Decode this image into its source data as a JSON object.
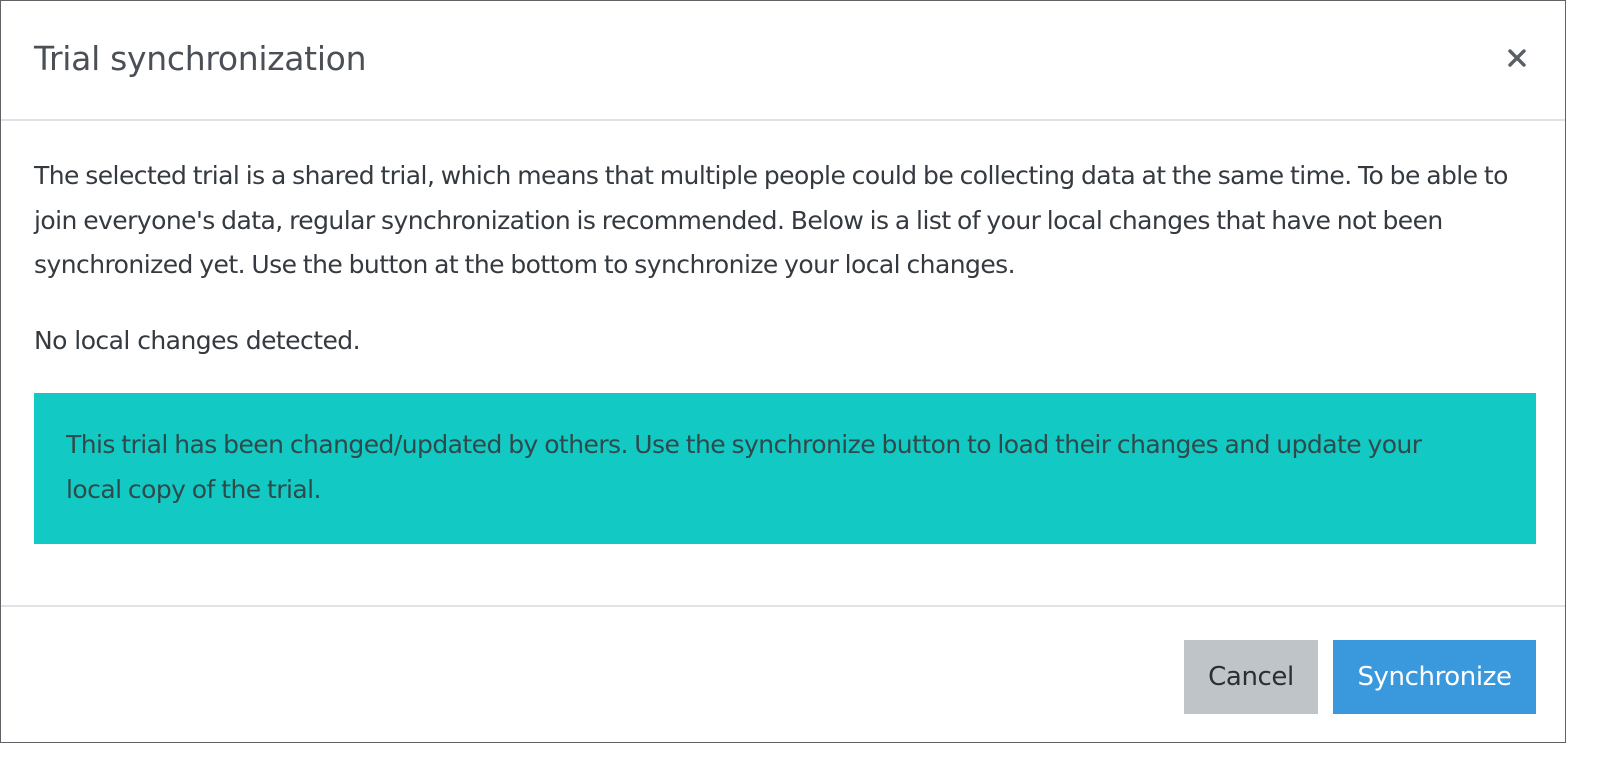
{
  "dialog": {
    "title": "Trial synchronization",
    "close_icon": "close-icon"
  },
  "body": {
    "intro": "The selected trial is a shared trial, which means that multiple people could be collecting data at the same time. To be able to join everyone's data, regular synchronization is recommended. Below is a list of your local changes that have not been synchronized yet. Use the button at the bottom to synchronize your local changes.",
    "no_changes": "No local changes detected.",
    "alert": {
      "text": "This trial has been changed/updated by others. Use the synchronize button to load their changes and update your local copy of the trial.",
      "color": "#13c9c3"
    }
  },
  "footer": {
    "cancel_label": "Cancel",
    "synchronize_label": "Synchronize",
    "primary_color": "#3a99dd",
    "secondary_color": "#bfc4c8"
  }
}
